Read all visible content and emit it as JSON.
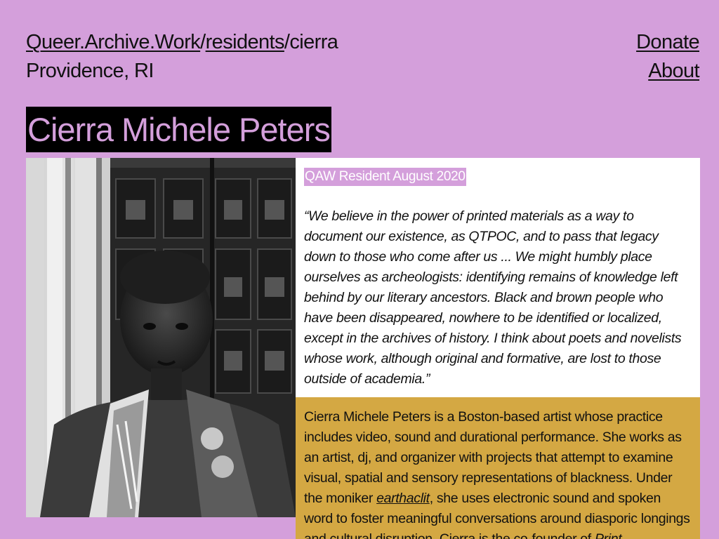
{
  "breadcrumb": {
    "site": "Queer.Archive.Work",
    "sep1": "/",
    "section": "residents",
    "sep2": "/",
    "current": "cierra",
    "location": "Providence, RI"
  },
  "nav": {
    "donate": "Donate",
    "about": "About"
  },
  "resident": {
    "name": "Cierra Michele Peters",
    "badge": "QAW Resident August 2020",
    "quote": "“We believe in the power of printed materials as a way to document our existence, as QTPOC, and to pass that legacy down to those who come after us ... We might humbly place ourselves as archeologists: identifying remains of knowledge left behind by our literary ancestors. Black and brown people who have been disappeared, nowhere to be identified or localized, except in the archives of history. I think about poets and novelists whose work, although original and formative, are lost to those outside of academia.”",
    "bio_part1": "Cierra Michele Peters is a Boston-based artist whose practice includes video, sound and durational performance. She works as an artist, dj, and organizer with projects that attempt to examine visual, spatial and sensory representations of blackness. Under the moniker ",
    "bio_link": "earthaclit",
    "bio_part2": ", she uses electronic sound and spoken word to foster meaningful conversations around diasporic longings and cultural disruption. Cierra is the co-founder of ",
    "bio_em": "Print"
  },
  "photo": {
    "alt": "Black and white portrait of Cierra Michele Peters wearing a patterned scarf in front of a carved wooden door"
  },
  "colors": {
    "background": "#d49fdb",
    "title_bg": "#000000",
    "bio_bg": "#d4a843",
    "quote_bg": "#ffffff"
  }
}
